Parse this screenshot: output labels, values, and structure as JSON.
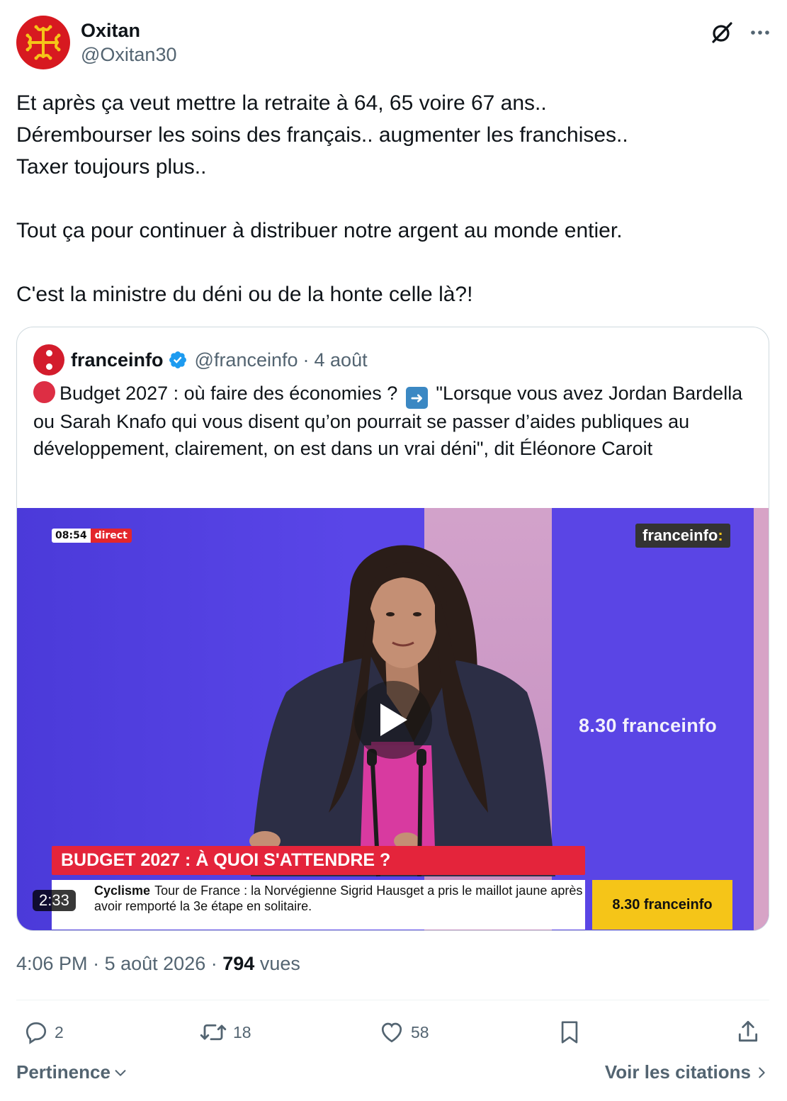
{
  "author": {
    "name": "Oxitan",
    "handle": "@Oxitan30"
  },
  "tweet": {
    "text": "Et après ça veut mettre la retraite à 64, 65 voire 67 ans..\nDérembourser les soins des français.. augmenter les franchises..\nTaxer toujours plus..\n\nTout ça pour continuer à distribuer notre argent au monde entier.\n\nC'est la ministre du déni ou de la honte celle là?!"
  },
  "quote": {
    "name": "franceinfo",
    "handle": "@franceinfo",
    "separator": "·",
    "date": "4 août",
    "text_part1": "Budget 2027 : où faire des économies ?",
    "text_part2": "\"Lorsque vous avez Jordan Bardella ou Sarah Knafo qui vous disent qu’on pourrait se passer d’aides publiques au développement, clairement, on est dans un vrai déni\", dit Éléonore Caroit",
    "video": {
      "clock": "08:54",
      "live_label": "direct",
      "channel_tag": "franceinfo",
      "channel_tag_colon": ":",
      "show_label": "8.30 franceinfo",
      "banner": "BUDGET 2027 : À QUOI S'ATTENDRE ?",
      "ticker_category": "Cyclisme",
      "ticker_text": "Tour de France : la Norvégienne Sigrid Hausget a pris le maillot jaune après avoir remporté la 3e étape en solitaire.",
      "ticker_box": "8.30 franceinfo",
      "duration": "2:33"
    }
  },
  "meta": {
    "time": "4:06 PM",
    "sep1": "·",
    "date": "5 août 2026",
    "sep2": "·",
    "views": "794",
    "views_label": "vues"
  },
  "actions": {
    "replies": "2",
    "reposts": "18",
    "likes": "58"
  },
  "footer": {
    "sort_label": "Pertinence",
    "quotes_label": "Voir les citations"
  },
  "colors": {
    "text": "#0f1419",
    "secondary": "#536471",
    "verified": "#1d9bf0",
    "franceinfo_red": "#d31c2c",
    "banner_red": "#e4243b",
    "ticker_yellow": "#f5c518"
  }
}
